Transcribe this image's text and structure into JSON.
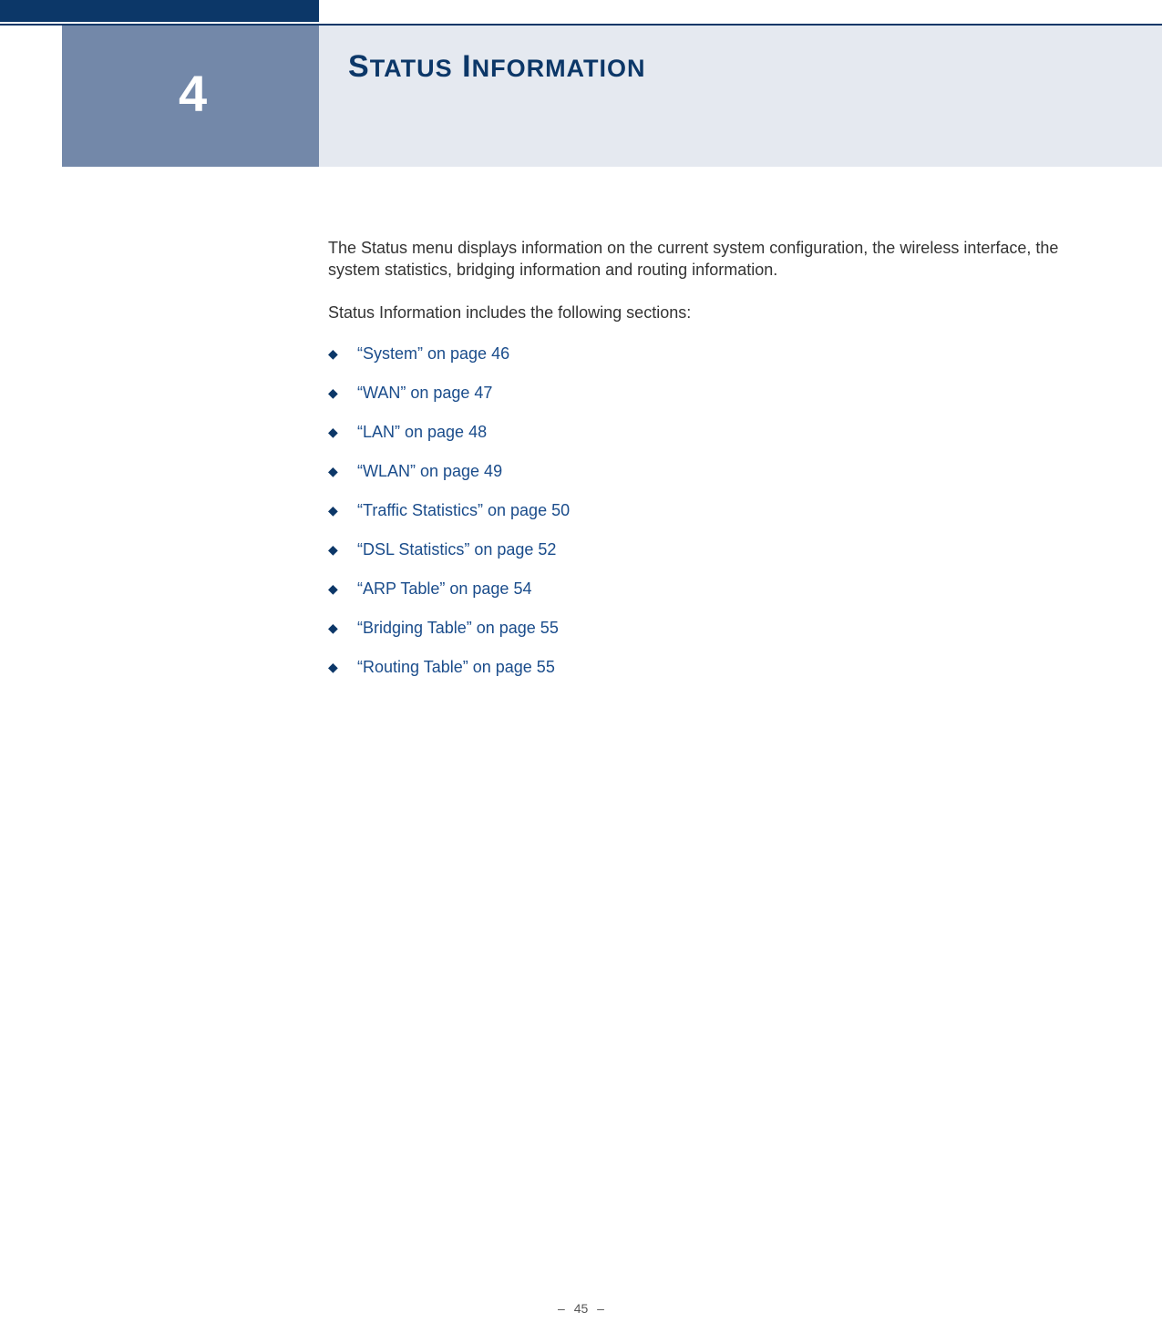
{
  "chapter": {
    "number": "4",
    "title_first_upper": "S",
    "title_first_rest": "TATUS",
    "title_second_upper": "I",
    "title_second_rest": "NFORMATION"
  },
  "intro": "The Status menu displays information on the current system configuration, the wireless interface, the system statistics, bridging information and routing information.",
  "sections_intro": "Status Information includes the following sections:",
  "sections": [
    {
      "label": "“System” on page 46"
    },
    {
      "label": "“WAN” on page 47"
    },
    {
      "label": "“LAN” on page 48"
    },
    {
      "label": "“WLAN” on page 49"
    },
    {
      "label": "“Traffic Statistics” on page 50"
    },
    {
      "label": "“DSL Statistics” on page 52"
    },
    {
      "label": "“ARP Table” on page 54"
    },
    {
      "label": "“Bridging Table” on page 55"
    },
    {
      "label": "“Routing Table” on page 55"
    }
  ],
  "footer": {
    "page_number": "45",
    "dash": "–"
  }
}
